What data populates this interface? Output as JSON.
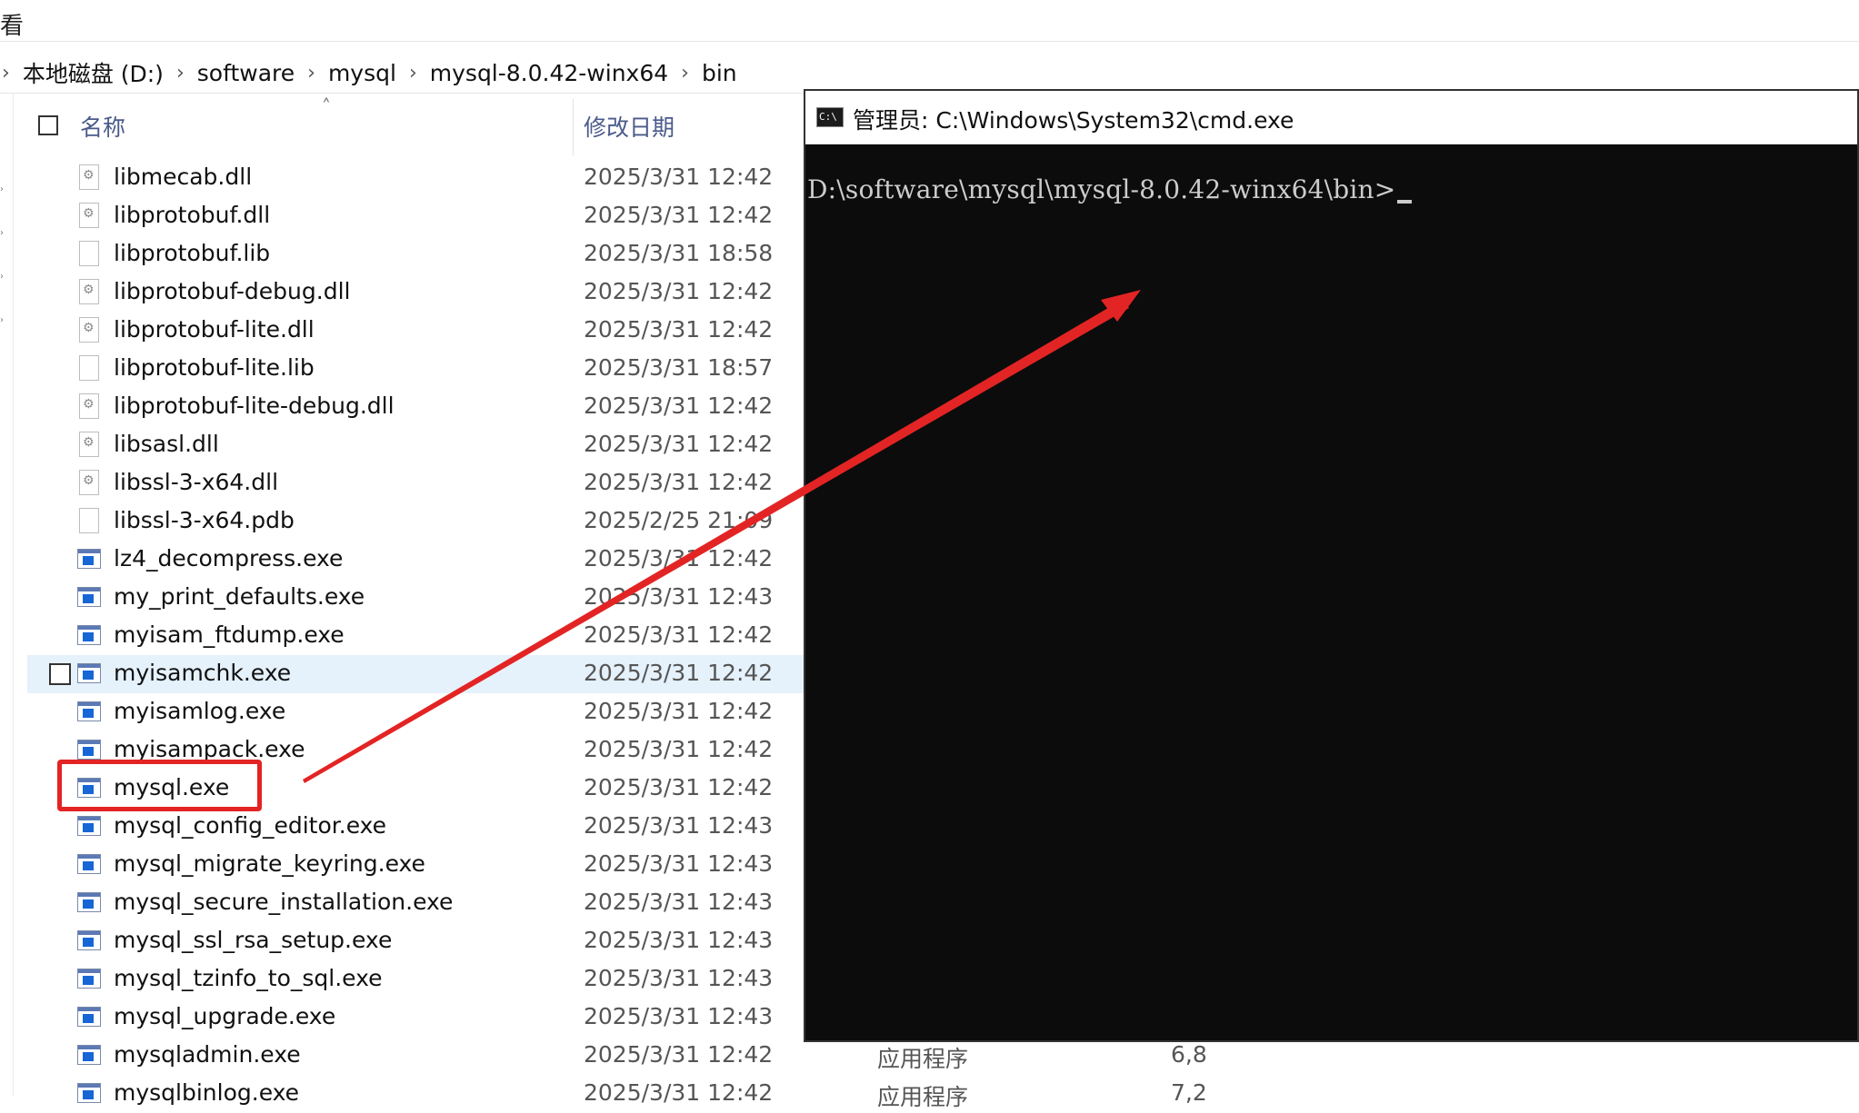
{
  "menu": {
    "view_label": "看"
  },
  "breadcrumb": {
    "items": [
      "本地磁盘 (D:)",
      "software",
      "mysql",
      "mysql-8.0.42-winx64",
      "bin"
    ]
  },
  "columns": {
    "name": "名称",
    "date_modified": "修改日期"
  },
  "files": [
    {
      "name": "libmecab.dll",
      "date": "2025/3/31 12:42",
      "icon": "dll-file-icon"
    },
    {
      "name": "libprotobuf.dll",
      "date": "2025/3/31 12:42",
      "icon": "dll-file-icon"
    },
    {
      "name": "libprotobuf.lib",
      "date": "2025/3/31 18:58",
      "icon": "blank-file-icon"
    },
    {
      "name": "libprotobuf-debug.dll",
      "date": "2025/3/31 12:42",
      "icon": "dll-file-icon"
    },
    {
      "name": "libprotobuf-lite.dll",
      "date": "2025/3/31 12:42",
      "icon": "dll-file-icon"
    },
    {
      "name": "libprotobuf-lite.lib",
      "date": "2025/3/31 18:57",
      "icon": "blank-file-icon"
    },
    {
      "name": "libprotobuf-lite-debug.dll",
      "date": "2025/3/31 12:42",
      "icon": "dll-file-icon"
    },
    {
      "name": "libsasl.dll",
      "date": "2025/3/31 12:42",
      "icon": "dll-file-icon"
    },
    {
      "name": "libssl-3-x64.dll",
      "date": "2025/3/31 12:42",
      "icon": "dll-file-icon"
    },
    {
      "name": "libssl-3-x64.pdb",
      "date": "2025/2/25 21:09",
      "icon": "blank-file-icon"
    },
    {
      "name": "lz4_decompress.exe",
      "date": "2025/3/31 12:42",
      "icon": "exe-file-icon"
    },
    {
      "name": "my_print_defaults.exe",
      "date": "2025/3/31 12:43",
      "icon": "exe-file-icon"
    },
    {
      "name": "myisam_ftdump.exe",
      "date": "2025/3/31 12:42",
      "icon": "exe-file-icon"
    },
    {
      "name": "myisamchk.exe",
      "date": "2025/3/31 12:42",
      "icon": "exe-file-icon",
      "hover": true
    },
    {
      "name": "myisamlog.exe",
      "date": "2025/3/31 12:42",
      "icon": "exe-file-icon"
    },
    {
      "name": "myisampack.exe",
      "date": "2025/3/31 12:42",
      "icon": "exe-file-icon"
    },
    {
      "name": "mysql.exe",
      "date": "2025/3/31 12:42",
      "icon": "exe-file-icon",
      "highlighted": true
    },
    {
      "name": "mysql_config_editor.exe",
      "date": "2025/3/31 12:43",
      "icon": "exe-file-icon"
    },
    {
      "name": "mysql_migrate_keyring.exe",
      "date": "2025/3/31 12:43",
      "icon": "exe-file-icon"
    },
    {
      "name": "mysql_secure_installation.exe",
      "date": "2025/3/31 12:43",
      "icon": "exe-file-icon"
    },
    {
      "name": "mysql_ssl_rsa_setup.exe",
      "date": "2025/3/31 12:43",
      "icon": "exe-file-icon"
    },
    {
      "name": "mysql_tzinfo_to_sql.exe",
      "date": "2025/3/31 12:43",
      "icon": "exe-file-icon"
    },
    {
      "name": "mysql_upgrade.exe",
      "date": "2025/3/31 12:43",
      "icon": "exe-file-icon"
    },
    {
      "name": "mysqladmin.exe",
      "date": "2025/3/31 12:42",
      "icon": "exe-file-icon",
      "type": "应用程序",
      "size": "6,8"
    },
    {
      "name": "mysqlbinlog.exe",
      "date": "2025/3/31 12:42",
      "icon": "exe-file-icon",
      "type": "应用程序",
      "size": "7,2"
    }
  ],
  "cmd": {
    "title": "管理员: C:\\Windows\\System32\\cmd.exe",
    "icon_text": "C:\\",
    "prompt": "D:\\software\\mysql\\mysql-8.0.42-winx64\\bin>"
  },
  "colors": {
    "annotation_red": "#e32424",
    "hover_row": "#e5f1fb",
    "console_bg": "#0c0c0c"
  }
}
